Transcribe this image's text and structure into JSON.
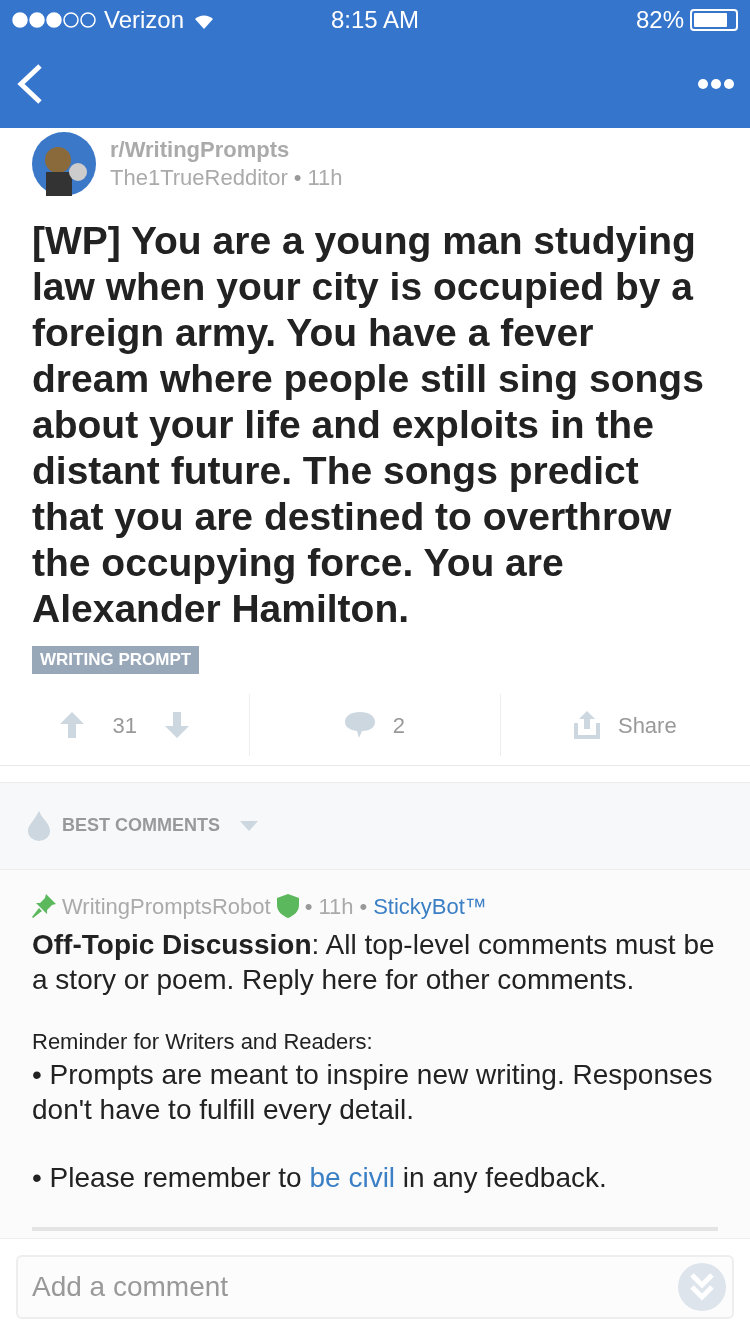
{
  "status_bar": {
    "carrier": "Verizon",
    "time": "8:15 AM",
    "battery": "82%"
  },
  "post": {
    "subreddit": "r/WritingPrompts",
    "author": "The1TrueRedditor",
    "separator": "•",
    "age": "11h",
    "title": "[WP] You are a young man studying law when your city is occupied by a foreign army. You have a fever dream where people still sing songs about your life and exploits in the distant future. The songs predict that you are destined to overthrow the occupying force. You are Alexander Hamilton.",
    "flair": "WRITING PROMPT",
    "score": "31",
    "comments": "2",
    "share": "Share"
  },
  "sort": {
    "label": "BEST COMMENTS"
  },
  "comment": {
    "stickied": true,
    "author": "WritingPromptsRobot",
    "moderator": true,
    "separator_1": "•",
    "age": "11h",
    "separator_2": "•",
    "flair": "StickyBot™",
    "paragraphs": [
      {
        "kind": "lead",
        "bold": "Off-Topic Discussion",
        "text": ": All top-level comments must be a story or poem. Reply here for other comments."
      },
      {
        "kind": "small",
        "text": "Reminder for Writers and Readers:"
      },
      {
        "kind": "plain",
        "text": "• Prompts are meant to inspire new writing. Responses don't have to fulfill every detail."
      },
      {
        "kind": "link",
        "before": "• Please remember to ",
        "link": "be civil",
        "after": " in any feedback."
      }
    ]
  },
  "composer": {
    "placeholder": "Add a comment"
  }
}
